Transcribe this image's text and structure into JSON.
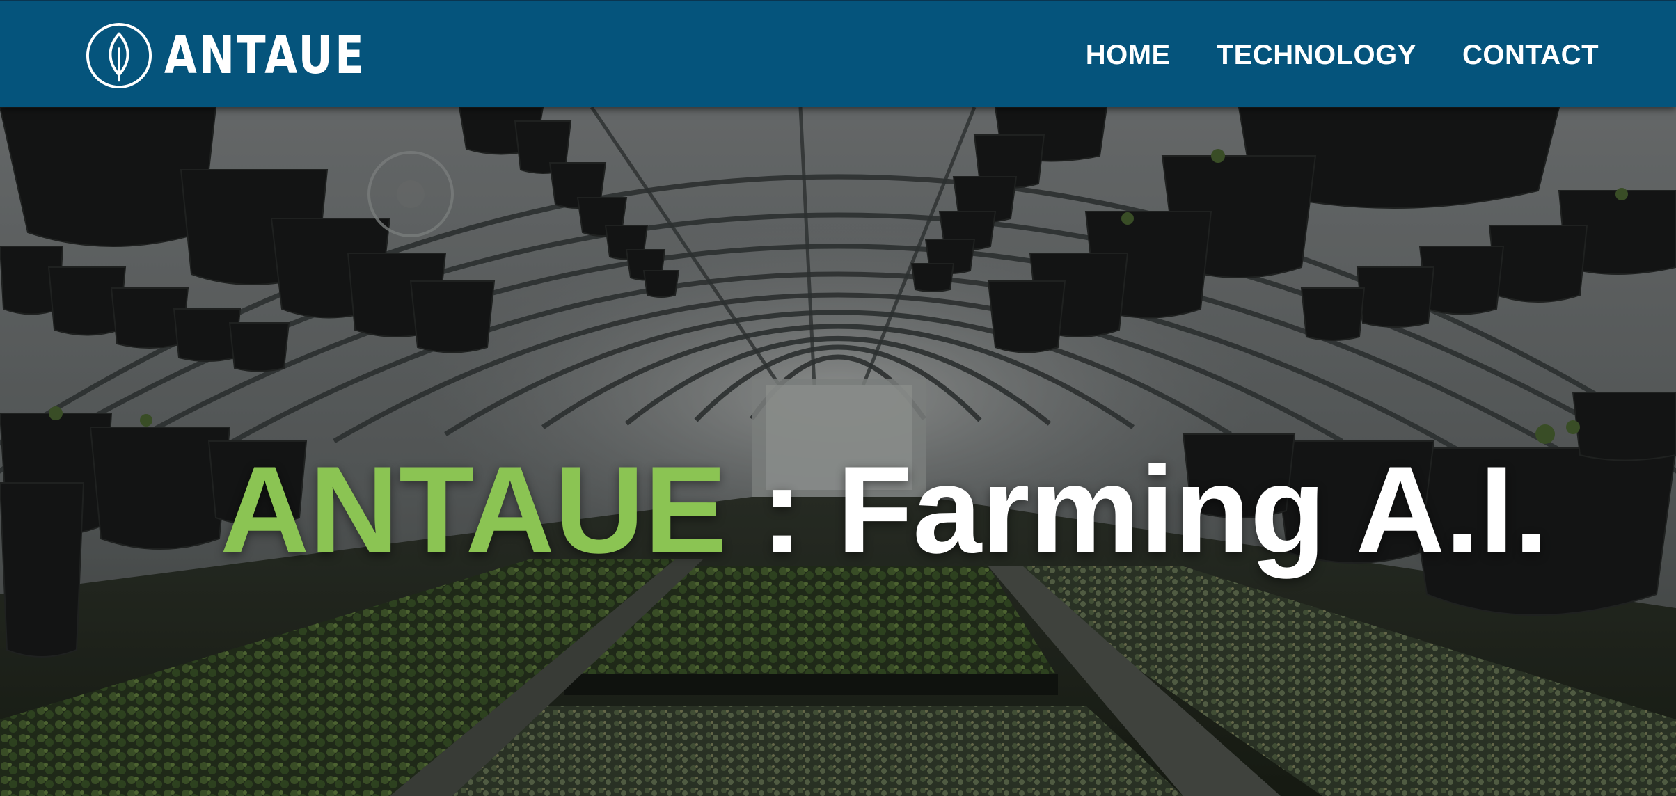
{
  "header": {
    "logo_text": "ANTAUE",
    "nav": [
      {
        "label": "HOME"
      },
      {
        "label": "TECHNOLOGY"
      },
      {
        "label": "CONTACT"
      }
    ]
  },
  "hero": {
    "title_brand": "ANTAUE",
    "title_rest": " : Farming A.I.",
    "background": "greenhouse-photo"
  },
  "colors": {
    "header_bg": "#05547c",
    "brand_green": "#8bc453",
    "text_white": "#ffffff"
  },
  "icons": {
    "logo": "leaf-icon"
  }
}
